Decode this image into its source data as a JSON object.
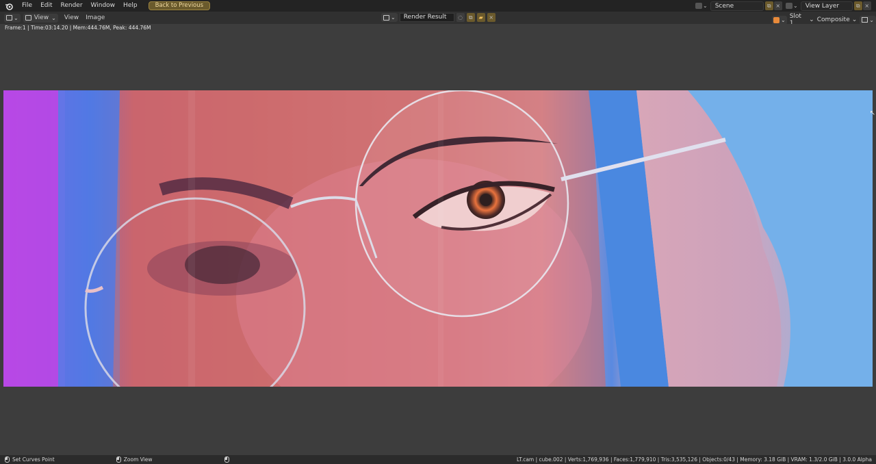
{
  "topbar": {
    "menu": [
      "File",
      "Edit",
      "Render",
      "Window",
      "Help"
    ],
    "back_button": "Back to Previous",
    "scene_label": "Scene",
    "view_layer_label": "View Layer"
  },
  "editor_header": {
    "view_menu": "View",
    "image_menu": "Image",
    "render_result": "Render Result",
    "slot": "Slot 1",
    "composite": "Composite",
    "view_dropdown": "View"
  },
  "info_line": "Frame:1 | Time:03:14.20 | Mem:444.76M, Peak: 444.76M",
  "statusbar": {
    "left_action": "Set Curves Point",
    "middle_action": "Zoom View",
    "stats": "LT.cam | cube.002 | Verts:1,769,936 | Faces:1,779,910 | Tris:3,535,126 | Objects:0/43 | Memory: 3.18 GiB | VRAM: 1.3/2.0 GiB | 3.0.0 Alpha"
  },
  "colors": {
    "accent_orange": "#6a5a2c",
    "viewport_bg": "#3d3d3d",
    "topbar_bg": "#232323"
  },
  "icons": [
    "blender-logo-icon",
    "editor-type-icon",
    "image-icon",
    "scene-icon",
    "view-layer-icon",
    "shield-icon",
    "close-icon",
    "folder-icon",
    "render-slot-icon",
    "mouse-icon"
  ]
}
